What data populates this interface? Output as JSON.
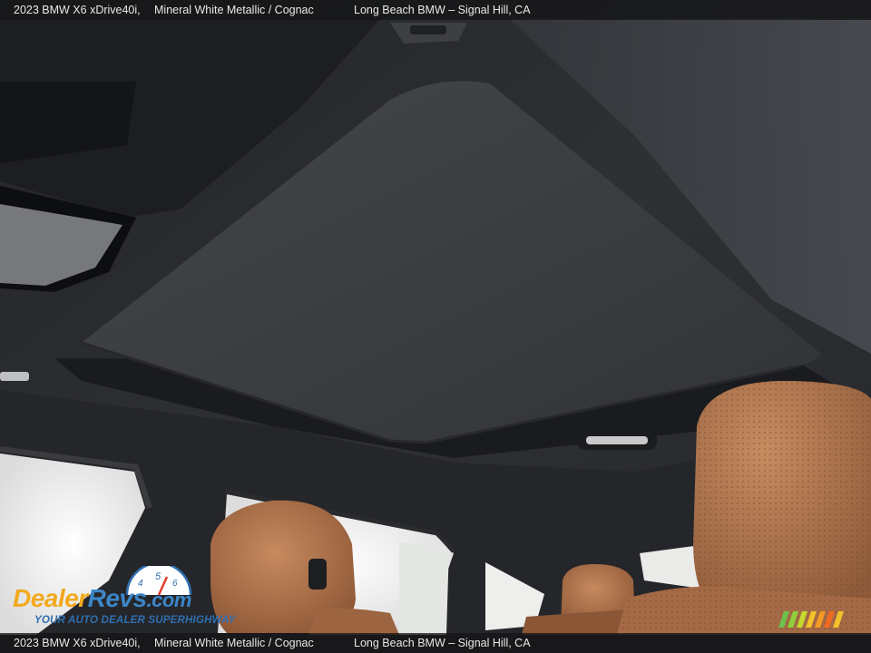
{
  "caption": {
    "model": "2023 BMW X6 xDrive40i,",
    "color": "Mineral White Metallic / Cognac",
    "dealer": "Long Beach BMW – Signal Hill, CA"
  },
  "watermark": {
    "brand_part1": "Dealer",
    "brand_part2": "Revs",
    "brand_part3": ".com",
    "tagline": "YOUR AUTO DEALER SUPERHIGHWAY",
    "gauge_numbers": [
      "4",
      "5",
      "6"
    ]
  },
  "colors": {
    "headliner": "#2c2e33",
    "sunshade": "#3a3c40",
    "leather": "#b0714a",
    "window_glare": "#f2f2f0",
    "logo_orange": "#f3a91d",
    "logo_blue": "#3c86c8"
  }
}
